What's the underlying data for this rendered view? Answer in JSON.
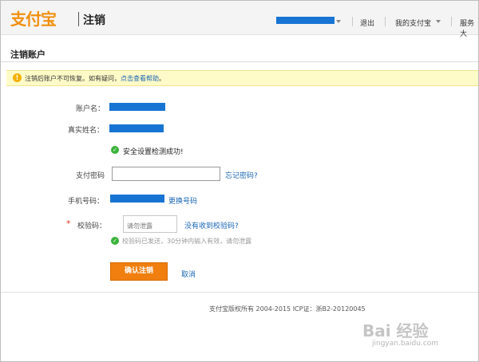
{
  "header": {
    "logo_text": "支付宝",
    "page_heading": "注销",
    "nav": {
      "logout": "退出",
      "my_alipay": "我的支付宝",
      "service": "服务大"
    }
  },
  "section_title": "注销账户",
  "notice": {
    "icon": "warning-icon",
    "text": "注销后账户不可恢复。如有疑问，",
    "link": "点击查看帮助",
    "end": "。"
  },
  "form": {
    "account_label": "账户名：",
    "realname_label": "真实姓名：",
    "security_check": "安全设置检测成功!",
    "pay_password_label": "支付密码",
    "pay_password_value": "",
    "forgot_password_link": "忘记密码?",
    "phone_label": "手机号码：",
    "change_phone_link": "更换号码",
    "required_mark": "*",
    "code_label": "校验码：",
    "code_placeholder": "请勿泄露",
    "code_value": "",
    "not_received_link": "没有收到校验码?",
    "code_hint": "校验码已发送，30分钟内输入有效，请勿泄露"
  },
  "buttons": {
    "confirm": "确认注销",
    "cancel": "取消"
  },
  "footer": {
    "copyright": "支付宝版权所有 2004-2015 ICP证：浙B2-20120045"
  },
  "watermark": {
    "main": "Bai 经验",
    "sub": "jingyan.baidu.com"
  },
  "colors": {
    "accent": "#f07f10",
    "link": "#1a66b5",
    "notice_bg": "#fffbc8",
    "mask": "#1874d3",
    "success": "#3bb33b"
  }
}
